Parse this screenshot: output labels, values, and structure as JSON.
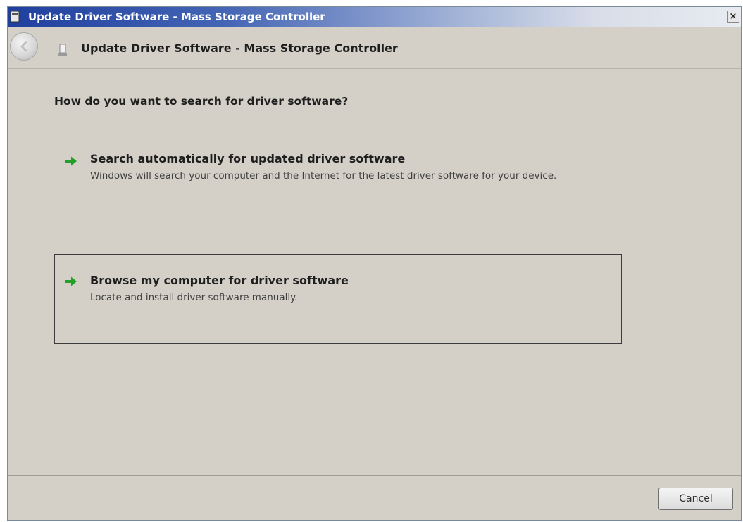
{
  "window": {
    "title": "Update Driver Software - Mass Storage Controller",
    "close_label": "×"
  },
  "header": {
    "title": "Update Driver Software - Mass Storage Controller"
  },
  "main": {
    "question": "How do you want to search for driver software?",
    "options": [
      {
        "title": "Search automatically for updated driver software",
        "description": "Windows will search your computer and the Internet for the latest driver software for your device."
      },
      {
        "title": "Browse my computer for driver software",
        "description": "Locate and install driver software manually."
      }
    ]
  },
  "footer": {
    "cancel_label": "Cancel"
  },
  "colors": {
    "accent_arrow": "#22a02a",
    "title_bar": "#1f3f9e",
    "window_background": "#d4d0c8"
  }
}
